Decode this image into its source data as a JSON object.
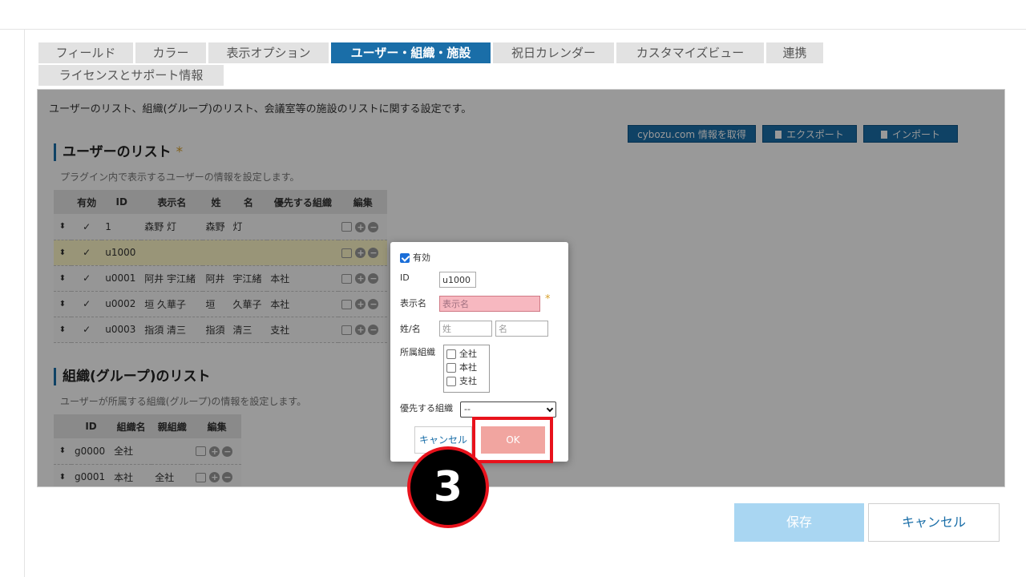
{
  "tabs": {
    "row1": [
      "フィールド",
      "カラー",
      "表示オプション",
      "ユーザー・組織・施設",
      "祝日カレンダー",
      "カスタマイズビュー",
      "連携"
    ],
    "row2": [
      "ライセンスとサポート情報"
    ],
    "active": "ユーザー・組織・施設"
  },
  "panel": {
    "description": "ユーザーのリスト、組織(グループ)のリスト、会議室等の施設のリストに関する設定です。",
    "actions": {
      "fetch": "cybozu.com 情報を取得",
      "export": "エクスポート",
      "import": "インポート"
    },
    "user_section": {
      "title": "ユーザーのリスト",
      "required_mark": "*",
      "subtitle": "プラグイン内で表示するユーザーの情報を設定します。",
      "columns": [
        "有効",
        "ID",
        "表示名",
        "姓",
        "名",
        "優先する組織",
        "編集"
      ],
      "rows": [
        {
          "enabled": "✓",
          "id": "1",
          "display": "森野 灯",
          "last": "森野",
          "first": "灯",
          "org": ""
        },
        {
          "enabled": "✓",
          "id": "u1000",
          "display": "",
          "last": "",
          "first": "",
          "org": ""
        },
        {
          "enabled": "✓",
          "id": "u0001",
          "display": "阿井 宇江緒",
          "last": "阿井",
          "first": "宇江緒",
          "org": "本社"
        },
        {
          "enabled": "✓",
          "id": "u0002",
          "display": "垣 久華子",
          "last": "垣",
          "first": "久華子",
          "org": "本社"
        },
        {
          "enabled": "✓",
          "id": "u0003",
          "display": "指須 清三",
          "last": "指須",
          "first": "清三",
          "org": "支社"
        }
      ]
    },
    "org_section": {
      "title": "組織(グループ)のリスト",
      "subtitle": "ユーザーが所属する組織(グループ)の情報を設定します。",
      "columns": [
        "ID",
        "組織名",
        "親組織",
        "編集"
      ],
      "rows": [
        {
          "id": "g0000",
          "name": "全社",
          "parent": ""
        },
        {
          "id": "g0001",
          "name": "本社",
          "parent": "全社"
        }
      ]
    }
  },
  "dialog": {
    "enabled_label": "有効",
    "id_label": "ID",
    "id_value": "u1000",
    "display_label": "表示名",
    "display_placeholder": "表示名",
    "required_mark": "*",
    "name_label": "姓/名",
    "last_placeholder": "姓",
    "first_placeholder": "名",
    "org_label": "所属組織",
    "org_options": [
      "全社",
      "本社",
      "支社"
    ],
    "priority_label": "優先する組織",
    "priority_value": "--",
    "cancel": "キャンセル",
    "ok": "OK"
  },
  "step_number": "3",
  "footer": {
    "save": "保存",
    "cancel": "キャンセル"
  },
  "colors": {
    "accent": "#1a6ea8",
    "highlight_frame": "#e8121c",
    "ok_button": "#f1a5a0",
    "save_button": "#a9d6f2"
  }
}
